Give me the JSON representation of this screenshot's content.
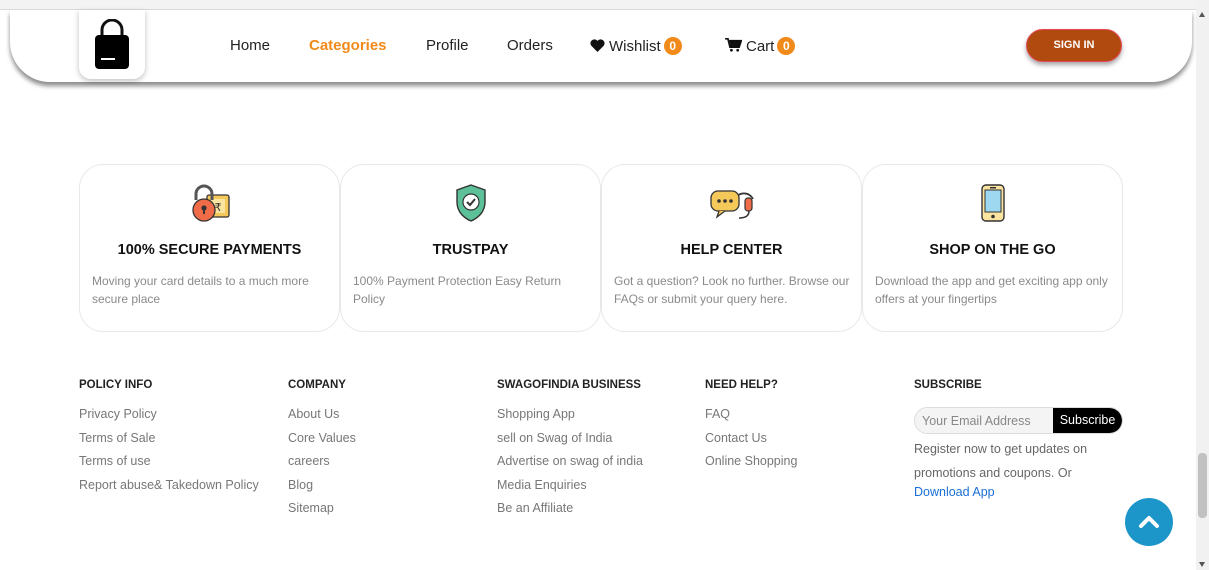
{
  "header": {
    "logo_icon": "shopping-bag-icon",
    "nav": [
      {
        "label": "Home",
        "active": false
      },
      {
        "label": "Categories",
        "active": true
      },
      {
        "label": "Profile",
        "active": false
      },
      {
        "label": "Orders",
        "active": false
      }
    ],
    "wishlist": {
      "label": "Wishlist",
      "count": "0",
      "icon": "heart-icon"
    },
    "cart": {
      "label": "Cart",
      "count": "0",
      "icon": "cart-icon"
    },
    "signin_label": "SIGN IN",
    "accent_color": "#f28a1a"
  },
  "features": [
    {
      "icon": "padlock-money-icon",
      "title": "100% SECURE PAYMENTS",
      "desc": "Moving your card details to a much more secure place"
    },
    {
      "icon": "shield-check-icon",
      "title": "TRUSTPAY",
      "desc": "100% Payment Protection Easy Return Policy"
    },
    {
      "icon": "chat-headset-icon",
      "title": "HELP CENTER",
      "desc": "Got a question? Look no further. Browse our FAQs or submit your query here."
    },
    {
      "icon": "smartphone-icon",
      "title": "SHOP ON THE GO",
      "desc": "Download the app and get exciting app only offers at your fingertips"
    }
  ],
  "footer": {
    "columns": [
      {
        "heading": "POLICY INFO",
        "links": [
          "Privacy Policy",
          "Terms of Sale",
          "Terms of use",
          "Report abuse& Takedown Policy"
        ]
      },
      {
        "heading": "COMPANY",
        "links": [
          "About Us",
          "Core Values",
          "careers",
          "Blog",
          "Sitemap"
        ]
      },
      {
        "heading": "SWAGOFINDIA BUSINESS",
        "links": [
          "Shopping App",
          "sell on Swag of India",
          "Advertise on swag of india",
          "Media Enquiries",
          "Be an Affiliate"
        ]
      },
      {
        "heading": "NEED HELP?",
        "links": [
          "FAQ",
          "Contact Us",
          "Online Shopping"
        ]
      }
    ],
    "subscribe": {
      "heading": "SUBSCRIBE",
      "placeholder": "Your Email Address",
      "button": "Subscribe",
      "text": "Register now to get updates on promotions and coupons. Or",
      "download_link": "Download App"
    }
  },
  "scroll_to_top_icon": "chevron-up-icon"
}
